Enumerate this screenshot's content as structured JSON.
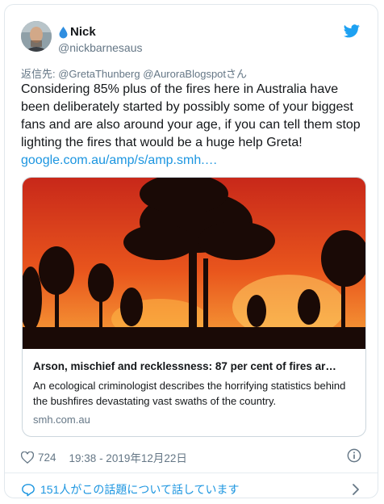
{
  "user": {
    "name": "Nick",
    "handle": "@nickbarnesaus",
    "name_emoji_icon": "droplet-icon"
  },
  "reply": {
    "prefix": "返信先: ",
    "mentions": "@GretaThunberg @AuroraBlogspot",
    "suffix": "さん"
  },
  "tweet": {
    "text": "Considering 85% plus of the fires here in Australia have been deliberately started by possibly some of your biggest fans and are also around your age, if you can tell them stop lighting the fires that would be a huge help Greta!",
    "link": "google.com.au/amp/s/amp.smh.…"
  },
  "link_card": {
    "title": "Arson, mischief and recklessness: 87 per cent of fires ar…",
    "description": "An ecological criminologist describes the horrifying statistics behind the bushfires devastating vast swaths of the country.",
    "domain": "smh.com.au"
  },
  "meta": {
    "likes": "724",
    "timestamp": "19:38 - 2019年12月22日"
  },
  "footer": {
    "conversation_text": "151人がこの話題について話しています"
  },
  "colors": {
    "accent": "#1b95e0",
    "secondary_text": "#657786",
    "fire": "#e8501a"
  }
}
